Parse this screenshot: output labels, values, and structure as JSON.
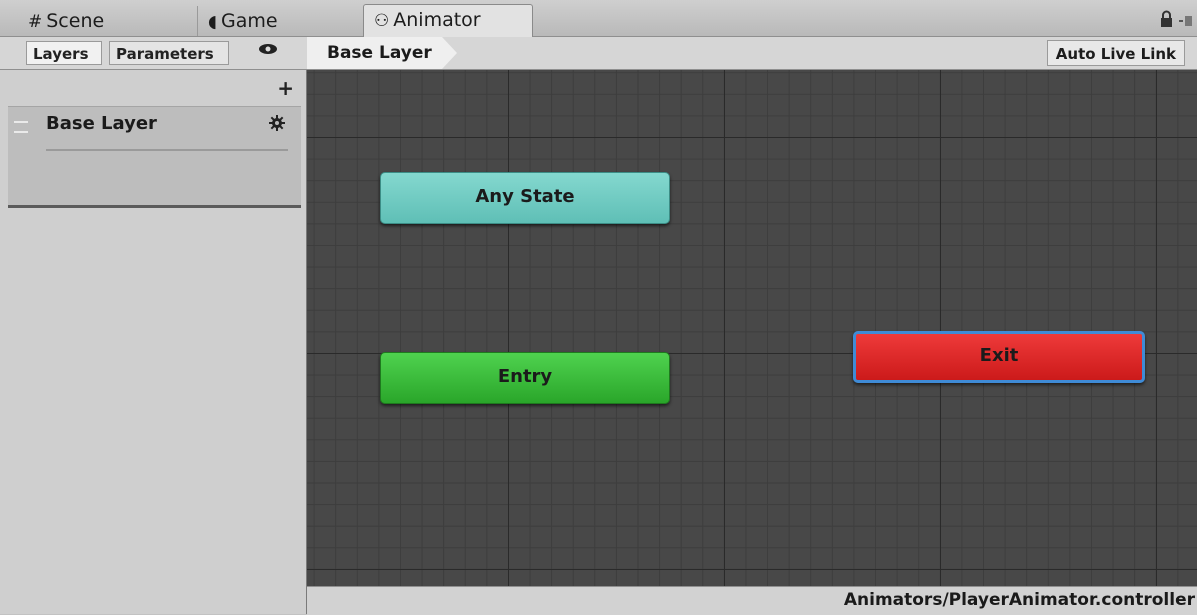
{
  "window_tabs": [
    {
      "icon": "#",
      "label": "Scene"
    },
    {
      "icon": "◖",
      "label": "Game"
    },
    {
      "icon": "⚇",
      "label": "Animator"
    }
  ],
  "toolbar": {
    "layers_tab": "Layers",
    "parameters_tab": "Parameters",
    "breadcrumb": "Base Layer",
    "auto_live_link": "Auto Live Link"
  },
  "layers_panel": {
    "add_symbol": "+",
    "layers": [
      {
        "name": "Base Layer"
      }
    ]
  },
  "graph": {
    "nodes": [
      {
        "label": "Any State",
        "color": "#6ccbc2"
      },
      {
        "label": "Entry",
        "color": "#3cbf3c"
      },
      {
        "label": "Exit",
        "color": "#e02a2a"
      }
    ]
  },
  "status": {
    "path": "Animators/PlayerAnimator.controller"
  }
}
